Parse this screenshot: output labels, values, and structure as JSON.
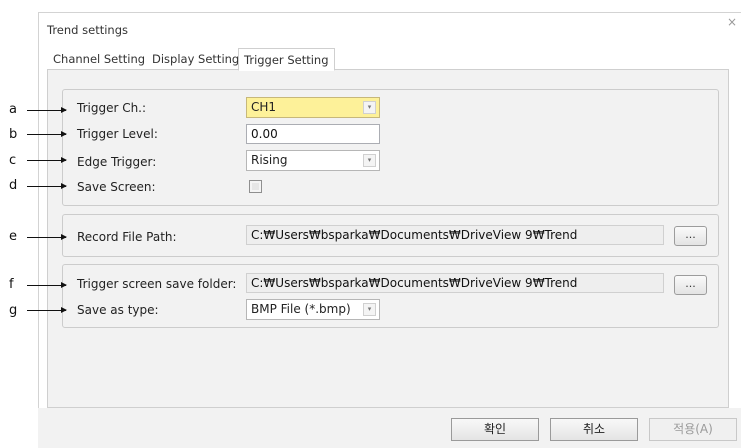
{
  "window": {
    "title": "Trend settings",
    "close_glyph": "×"
  },
  "tabs": [
    {
      "label": "Channel Setting",
      "active": false
    },
    {
      "label": "Display Setting",
      "active": false
    },
    {
      "label": "Trigger Setting",
      "active": true
    }
  ],
  "trigger": {
    "channel_label": "Trigger Ch.:",
    "channel_value": "CH1",
    "level_label": "Trigger Level:",
    "level_value": "0.00",
    "edge_label": "Edge Trigger:",
    "edge_value": "Rising",
    "save_screen_label": "Save Screen:",
    "save_screen_checked": false
  },
  "record": {
    "path_label": "Record File Path:",
    "path_value": "C:₩Users₩bsparka₩Documents₩DriveView 9₩Trend",
    "browse_label": "..."
  },
  "save": {
    "folder_label": "Trigger screen save folder:",
    "folder_value": "C:₩Users₩bsparka₩Documents₩DriveView 9₩Trend",
    "browse_label": "...",
    "type_label": "Save as type:",
    "type_value": "BMP File (*.bmp)"
  },
  "buttons": {
    "ok": "확인",
    "cancel": "취소",
    "apply": "적용(A)"
  },
  "annotations": [
    "a",
    "b",
    "c",
    "d",
    "e",
    "f",
    "g"
  ],
  "icons": {
    "dropdown_arrow": "▾"
  },
  "colors": {
    "highlight": "#fdf199",
    "panel": "#f2f2f2"
  }
}
